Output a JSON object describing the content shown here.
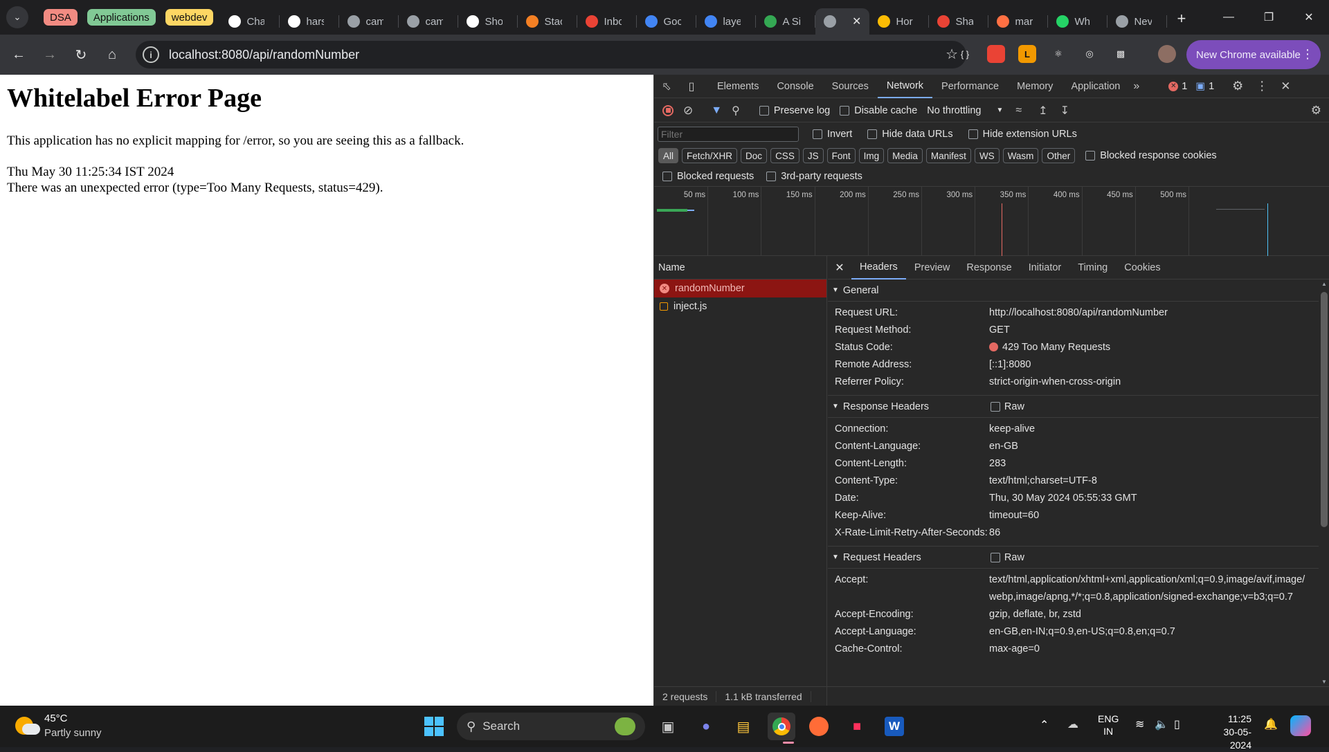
{
  "tab_strip": {
    "groups": [
      {
        "label": "DSA",
        "color": "#f28b82"
      },
      {
        "label": "Applications",
        "color": "#81c995"
      },
      {
        "label": "webdev",
        "color": "#fdd663"
      }
    ],
    "tabs": [
      {
        "label": "Cha",
        "icon": "chatgpt-icon"
      },
      {
        "label": "hars",
        "icon": "github-icon"
      },
      {
        "label": "cam",
        "icon": "globe-icon"
      },
      {
        "label": "cam",
        "icon": "globe-icon"
      },
      {
        "label": "Sho",
        "icon": "medium-icon"
      },
      {
        "label": "Stac",
        "icon": "stackoverflow-icon"
      },
      {
        "label": "Inbc",
        "icon": "gmail-icon"
      },
      {
        "label": "Goc",
        "icon": "google-icon"
      },
      {
        "label": "laye",
        "icon": "google-icon"
      },
      {
        "label": "A Si",
        "icon": "document-icon"
      },
      {
        "label": "",
        "icon": "globe-icon",
        "active": true
      },
      {
        "label": "Hor",
        "icon": "drive-icon"
      },
      {
        "label": "Sha",
        "icon": "photos-icon"
      },
      {
        "label": "mar",
        "icon": "app-icon"
      },
      {
        "label": "Wh",
        "icon": "whatsapp-icon"
      },
      {
        "label": "Nev",
        "icon": "globe-icon"
      }
    ]
  },
  "toolbar": {
    "url": "localhost:8080/api/randomNumber",
    "update_label": "New Chrome available"
  },
  "page": {
    "title": "Whitelabel Error Page",
    "message": "This application has no explicit mapping for /error, so you are seeing this as a fallback.",
    "timestamp": "Thu May 30 11:25:34 IST 2024",
    "error_line": "There was an unexpected error (type=Too Many Requests, status=429)."
  },
  "devtools": {
    "tabs": [
      "Elements",
      "Console",
      "Sources",
      "Network",
      "Performance",
      "Memory",
      "Application"
    ],
    "active_tab": "Network",
    "error_count": "1",
    "message_count": "1",
    "preserve_log": "Preserve log",
    "disable_cache": "Disable cache",
    "throttling": "No throttling",
    "filter_placeholder": "Filter",
    "invert": "Invert",
    "hide_data_urls": "Hide data URLs",
    "hide_extension_urls": "Hide extension URLs",
    "type_filters": [
      "All",
      "Fetch/XHR",
      "Doc",
      "CSS",
      "JS",
      "Font",
      "Img",
      "Media",
      "Manifest",
      "WS",
      "Wasm",
      "Other"
    ],
    "blocked_response_cookies": "Blocked response cookies",
    "blocked_requests": "Blocked requests",
    "third_party": "3rd-party requests",
    "timeline_ticks": [
      "50 ms",
      "100 ms",
      "150 ms",
      "200 ms",
      "250 ms",
      "300 ms",
      "350 ms",
      "400 ms",
      "450 ms",
      "500 ms"
    ],
    "name_header": "Name",
    "requests": [
      {
        "name": "randomNumber",
        "status": "error"
      },
      {
        "name": "inject.js",
        "status": "ok"
      }
    ],
    "status_bar": {
      "requests": "2 requests",
      "transferred": "1.1 kB transferred"
    },
    "detail_tabs": [
      "Headers",
      "Preview",
      "Response",
      "Initiator",
      "Timing",
      "Cookies"
    ],
    "general_title": "General",
    "general": [
      {
        "k": "Request URL:",
        "v": "http://localhost:8080/api/randomNumber"
      },
      {
        "k": "Request Method:",
        "v": "GET"
      },
      {
        "k": "Status Code:",
        "v": "429 Too Many Requests"
      },
      {
        "k": "Remote Address:",
        "v": "[::1]:8080"
      },
      {
        "k": "Referrer Policy:",
        "v": "strict-origin-when-cross-origin"
      }
    ],
    "response_headers_title": "Response Headers",
    "raw_label": "Raw",
    "response_headers": [
      {
        "k": "Connection:",
        "v": "keep-alive"
      },
      {
        "k": "Content-Language:",
        "v": "en-GB"
      },
      {
        "k": "Content-Length:",
        "v": "283"
      },
      {
        "k": "Content-Type:",
        "v": "text/html;charset=UTF-8"
      },
      {
        "k": "Date:",
        "v": "Thu, 30 May 2024 05:55:33 GMT"
      },
      {
        "k": "Keep-Alive:",
        "v": "timeout=60"
      },
      {
        "k": "X-Rate-Limit-Retry-After-Seconds:",
        "v": "86"
      }
    ],
    "request_headers_title": "Request Headers",
    "request_headers": [
      {
        "k": "Accept:",
        "v": "text/html,application/xhtml+xml,application/xml;q=0.9,image/avif,image/webp,image/apng,*/*;q=0.8,application/signed-exchange;v=b3;q=0.7"
      },
      {
        "k": "Accept-Encoding:",
        "v": "gzip, deflate, br, zstd"
      },
      {
        "k": "Accept-Language:",
        "v": "en-GB,en-IN;q=0.9,en-US;q=0.8,en;q=0.7"
      },
      {
        "k": "Cache-Control:",
        "v": "max-age=0"
      }
    ]
  },
  "taskbar": {
    "temperature": "45°C",
    "weather": "Partly sunny",
    "search": "Search",
    "lang_top": "ENG",
    "lang_bottom": "IN",
    "time": "11:25",
    "date": "30-05-2024"
  }
}
